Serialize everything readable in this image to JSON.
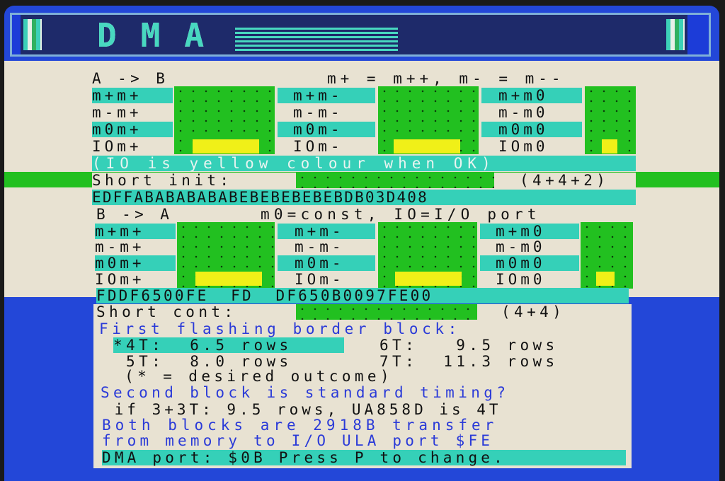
{
  "title": {
    "logo_text": "DMA"
  },
  "colors": {
    "cyan": "#35d0b8",
    "green": "#22c020",
    "yellow": "#f0f018",
    "paper": "#e8e2d2",
    "border_blue": "#2347d8",
    "text_blue": "#2a3ad8"
  },
  "section_ab": {
    "header_left": "A -> B",
    "header_right": "m+ = m++, m- = m--",
    "rows": [
      {
        "c1": "m+m+",
        "c2": "m+m-",
        "c3": "m+m0"
      },
      {
        "c1": "m-m+",
        "c2": "m-m-",
        "c3": "m-m0"
      },
      {
        "c1": "m0m+",
        "c2": "m0m-",
        "c3": "m0m0"
      },
      {
        "c1": "IOm+",
        "c2": "IOm-",
        "c3": "IOm0"
      }
    ],
    "note": "(IO is yellow colour when OK)",
    "short_init_label": "Short init:",
    "short_init_value": "(4+4+2)",
    "hex": "EDFFABABABABABEBEBEBEBEBDB03D408"
  },
  "section_ba": {
    "header_left": "B -> A",
    "header_right": "m0=const, IO=I/O port",
    "rows": [
      {
        "c1": "m+m+",
        "c2": "m+m-",
        "c3": "m+m0"
      },
      {
        "c1": "m-m+",
        "c2": "m-m-",
        "c3": "m-m0"
      },
      {
        "c1": "m0m+",
        "c2": "m0m-",
        "c3": "m0m0"
      },
      {
        "c1": "IOm+",
        "c2": "IOm-",
        "c3": "IOm0"
      }
    ],
    "hex": "FDDF6500FE  FD  DF650B0097FE00",
    "short_cont_label": "Short cont:",
    "short_cont_value": "(4+4)"
  },
  "info": {
    "line1": "First flashing border block:",
    "line2a": "*4T:  6.5 rows",
    "line2b": "6T:   9.5 rows",
    "line3a": " 5T:  8.0 rows",
    "line3b": "7T:  11.3 rows",
    "line4": "  (* = desired outcome)",
    "line5": "Second block is standard timing?",
    "line6": " if 3+3T: 9.5 rows, UA858D is 4T",
    "line7": "Both blocks are 2918B transfer",
    "line8": "from memory to I/O ULA port $FE",
    "line9": "DMA port: $0B Press P to change."
  }
}
